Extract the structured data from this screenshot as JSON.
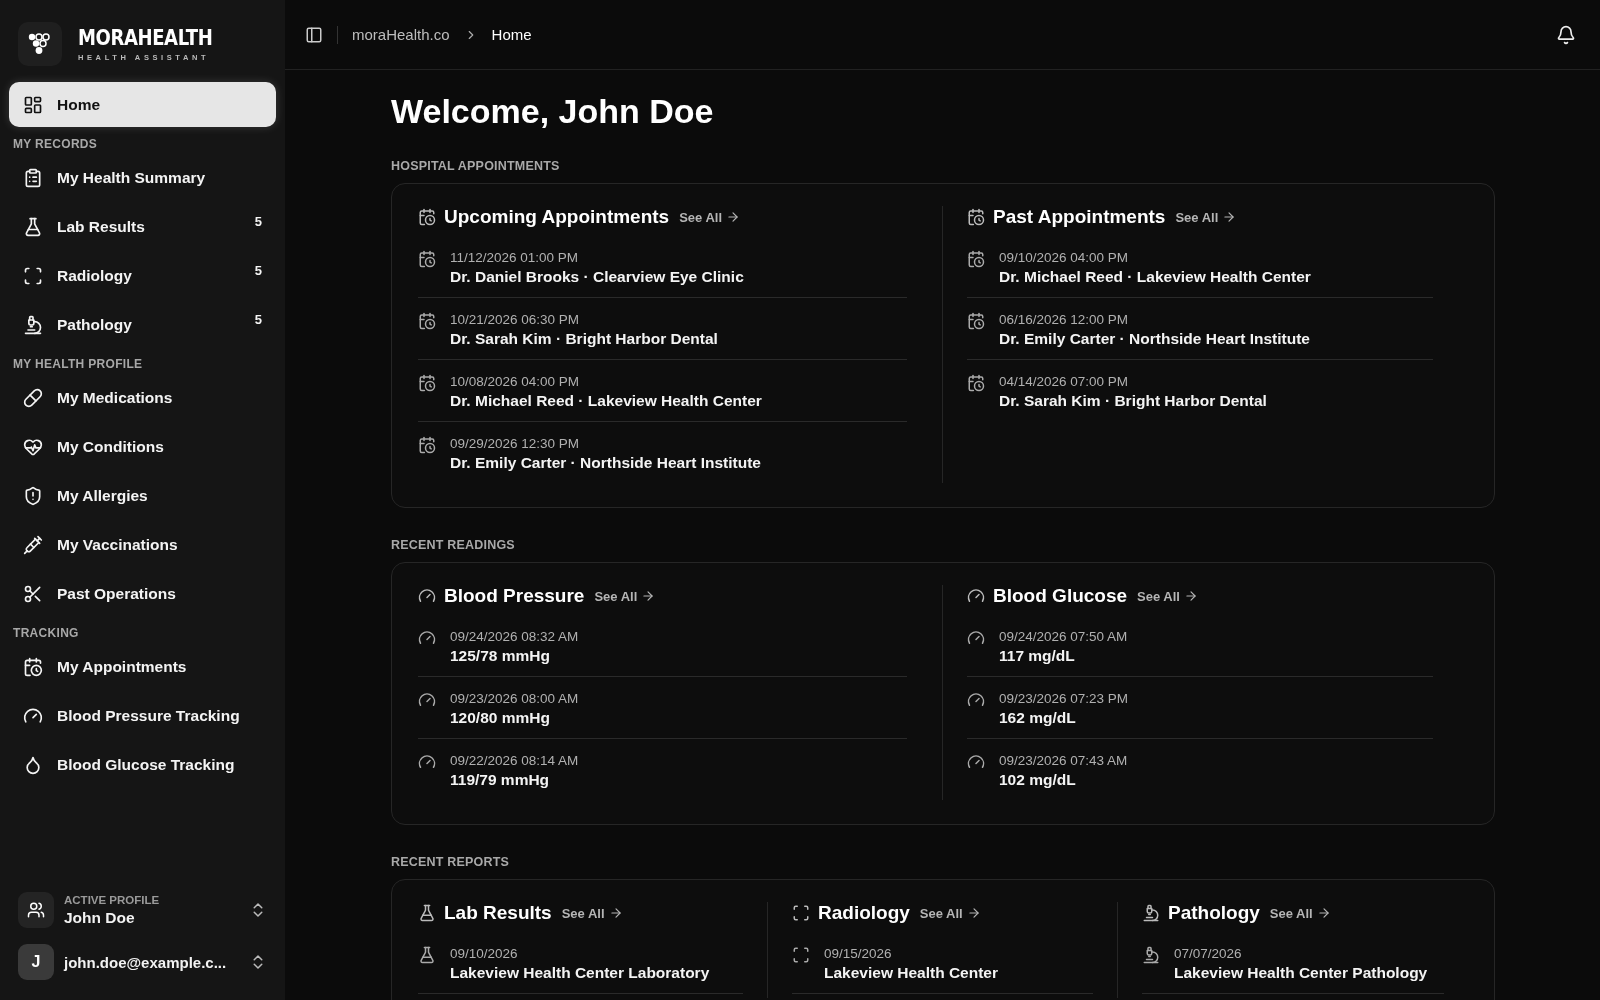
{
  "logo": {
    "name": "MORAHEALTH",
    "tagline": "HEALTH ASSISTANT"
  },
  "nav": {
    "home": {
      "label": "Home",
      "selected": true
    },
    "sections": [
      {
        "title": "MY RECORDS",
        "items": [
          {
            "label": "My Health Summary",
            "selected": false
          },
          {
            "label": "Lab Results",
            "count": "5",
            "selected": false
          },
          {
            "label": "Radiology",
            "count": "5",
            "selected": false
          },
          {
            "label": "Pathology",
            "count": "5",
            "selected": false
          }
        ]
      },
      {
        "title": "MY HEALTH PROFILE",
        "items": [
          {
            "label": "My Medications",
            "selected": false
          },
          {
            "label": "My Conditions",
            "selected": false
          },
          {
            "label": "My Allergies",
            "selected": false
          },
          {
            "label": "My Vaccinations",
            "selected": false
          },
          {
            "label": "Past Operations",
            "selected": false
          }
        ]
      },
      {
        "title": "TRACKING",
        "items": [
          {
            "label": "My Appointments",
            "selected": false
          },
          {
            "label": "Blood Pressure Tracking",
            "selected": false
          },
          {
            "label": "Blood Glucose Tracking",
            "selected": false
          }
        ]
      }
    ]
  },
  "profile": {
    "caption": "ACTIVE PROFILE",
    "name": "John Doe"
  },
  "account": {
    "initial": "J",
    "email": "john.doe@example.c..."
  },
  "breadcrumb": [
    "moraHealth.co",
    "Home"
  ],
  "welcome": "Welcome, John Doe",
  "sections": [
    {
      "title": "HOSPITAL APPOINTMENTS",
      "panels": [
        {
          "kind": "appointment",
          "title": "Upcoming Appointments",
          "link": "See All",
          "rows": [
            {
              "date": "11/12/2026 01:00 PM",
              "detail": "Dr. Daniel Brooks · Clearview Eye Clinic"
            },
            {
              "date": "10/21/2026 06:30 PM",
              "detail": "Dr. Sarah Kim · Bright Harbor Dental"
            },
            {
              "date": "10/08/2026 04:00 PM",
              "detail": "Dr. Michael Reed · Lakeview Health Center"
            },
            {
              "date": "09/29/2026 12:30 PM",
              "detail": "Dr. Emily Carter · Northside Heart Institute"
            }
          ]
        },
        {
          "kind": "appointment",
          "title": "Past Appointments",
          "link": "See All",
          "rows": [
            {
              "date": "09/10/2026 04:00 PM",
              "detail": "Dr. Michael Reed · Lakeview Health Center"
            },
            {
              "date": "06/16/2026 12:00 PM",
              "detail": "Dr. Emily Carter · Northside Heart Institute"
            },
            {
              "date": "04/14/2026 07:00 PM",
              "detail": "Dr. Sarah Kim · Bright Harbor Dental"
            }
          ]
        }
      ]
    },
    {
      "title": "RECENT READINGS",
      "panels": [
        {
          "kind": "reading",
          "title": "Blood Pressure",
          "link": "See All",
          "rows": [
            {
              "date": "09/24/2026 08:32 AM",
              "detail": "125/78 mmHg"
            },
            {
              "date": "09/23/2026 08:00 AM",
              "detail": "120/80 mmHg"
            },
            {
              "date": "09/22/2026 08:14 AM",
              "detail": "119/79 mmHg"
            }
          ]
        },
        {
          "kind": "reading",
          "title": "Blood Glucose",
          "link": "See All",
          "rows": [
            {
              "date": "09/24/2026 07:50 AM",
              "detail": "117 mg/dL"
            },
            {
              "date": "09/23/2026 07:23 PM",
              "detail": "162 mg/dL"
            },
            {
              "date": "09/23/2026 07:43 AM",
              "detail": "102 mg/dL"
            }
          ]
        }
      ]
    },
    {
      "title": "RECENT REPORTS",
      "panels": [
        {
          "kind": "lab",
          "title": "Lab Results",
          "link": "See All",
          "rows": [
            {
              "date": "09/10/2026",
              "detail": "Lakeview Health Center Laboratory"
            }
          ]
        },
        {
          "kind": "radiology",
          "title": "Radiology",
          "link": "See All",
          "rows": [
            {
              "date": "09/15/2026",
              "detail": "Lakeview Health Center"
            }
          ]
        },
        {
          "kind": "pathology",
          "title": "Pathology",
          "link": "See All",
          "rows": [
            {
              "date": "07/07/2026",
              "detail": "Lakeview Health Center Pathology"
            }
          ]
        }
      ]
    }
  ]
}
